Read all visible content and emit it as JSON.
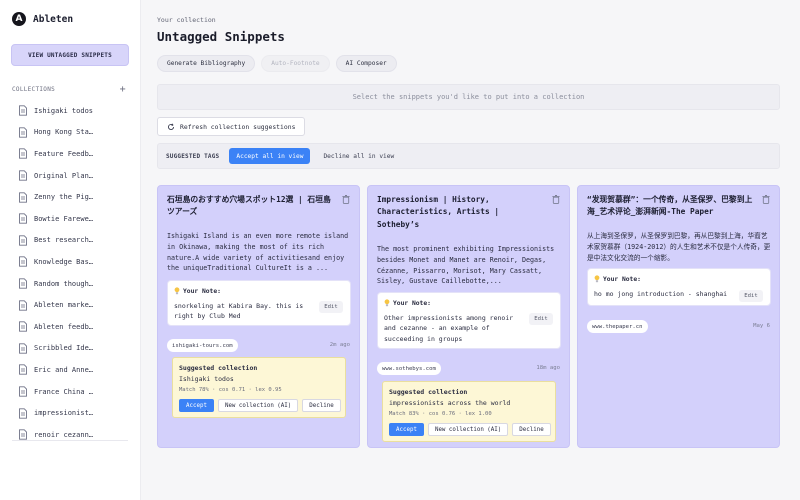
{
  "app": {
    "name": "Ableten",
    "logo_letter": "A"
  },
  "sidebar": {
    "view_untagged_label": "VIEW UNTAGGED SNIPPETS",
    "collections_header": "COLLECTIONS",
    "add_icon": "plus-icon",
    "items": [
      {
        "label": "Ishigaki todos"
      },
      {
        "label": "Hong Kong Sta…"
      },
      {
        "label": "Feature Feedb…"
      },
      {
        "label": "Original Plan…"
      },
      {
        "label": "Zenny the Pig…"
      },
      {
        "label": "Bowtie Farewe…"
      },
      {
        "label": "Best research…"
      },
      {
        "label": "Knowledge Bas…"
      },
      {
        "label": "Random though…"
      },
      {
        "label": "Ableten marke…"
      },
      {
        "label": "Ableten feedb…"
      },
      {
        "label": "Scribbled Ide…"
      },
      {
        "label": "Eric and Anne…"
      },
      {
        "label": "France China …"
      },
      {
        "label": "impressionist…"
      },
      {
        "label": "renoir cezann…"
      }
    ]
  },
  "header": {
    "eyebrow": "Your collection",
    "title": "Untagged Snippets"
  },
  "toolbar": {
    "buttons": [
      {
        "label": "Generate Bibliography",
        "disabled": false
      },
      {
        "label": "Auto-Footnote",
        "disabled": true
      },
      {
        "label": "AI Composer",
        "disabled": false
      }
    ]
  },
  "select_banner": "Select the snippets you'd like to put into a collection",
  "refresh_label": "Refresh collection suggestions",
  "tags_bar": {
    "label": "SUGGESTED TAGS",
    "accept_all": "Accept all in view",
    "decline_all": "Decline all in view"
  },
  "cards": [
    {
      "title": "石垣島のおすすめ穴場スポット12選 | 石垣島ツアーズ",
      "body": "Ishigaki Island is an even more remote island in Okinawa, making the most of its rich nature.A wide variety of activitiesand enjoy the uniqueTraditional CultureIt is a ...",
      "note_label": "Your Note:",
      "note_text": "snorkeling at Kabira Bay. this is right by Club Med",
      "edit_label": "Edit",
      "domain": "ishigaki-tours.com",
      "time": "2m ago",
      "suggestion": {
        "label": "Suggested collection",
        "name": "Ishigaki todos",
        "metrics": "Match 78% · cos 0.71 · lex 0.95",
        "accept": "Accept",
        "new_collection": "New collection (AI)",
        "decline": "Decline"
      }
    },
    {
      "title": "Impressionism | History, Characteristics, Artists | Sotheby’s",
      "body": "The most prominent exhibiting Impressionists besides Monet and Manet are Renoir, Degas, Cézanne, Pissarro, Morisot, Mary Cassatt, Sisley, Gustave Caillebotte,...",
      "note_label": "Your Note:",
      "note_text": "Other impressionists among renoir and cezanne - an example of succeeding in groups",
      "edit_label": "Edit",
      "domain": "www.sothebys.com",
      "time": "18m ago",
      "suggestion": {
        "label": "Suggested collection",
        "name": "impressionists across the world",
        "metrics": "Match 83% · cos 0.76 · lex 1.00",
        "accept": "Accept",
        "new_collection": "New collection (AI)",
        "decline": "Decline"
      }
    },
    {
      "title": "“发现贺慕群”：一个传奇，从圣保罗、巴黎到上海_艺术评论_澎湃新闻-The Paper",
      "body": "从上海到圣保罗，从圣保罗到巴黎，再从巴黎到上海，华裔艺术家贺慕群（1924-2012）的人生和艺术不仅是个人传奇，更是中法文化交流的一个缩影。",
      "note_label": "Your Note:",
      "note_text": "ho mo jong introduction - shanghai",
      "edit_label": "Edit",
      "domain": "www.thepaper.cn",
      "time": "May 6"
    }
  ],
  "colors": {
    "card_bg": "#d3d0fb",
    "accent": "#3b82f6",
    "suggestion_bg": "#fdf7d6",
    "sidebar_active": "#d8d5fa"
  }
}
